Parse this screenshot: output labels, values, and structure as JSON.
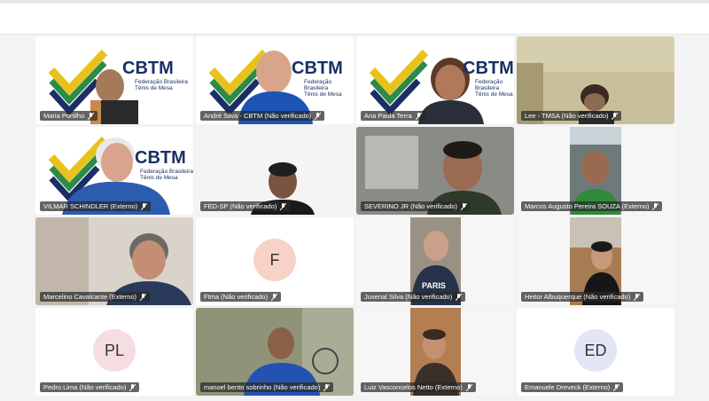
{
  "brand": {
    "logo_text": "CBTM",
    "logo_sub_1": "Federação Brasileira",
    "logo_sub_2": "Tênis de Mesa"
  },
  "participants": [
    {
      "name": "Maria Portilho"
    },
    {
      "name": "André Silva - CBTM (Não verificado)"
    },
    {
      "name": "Ana Paula Terra"
    },
    {
      "name": "Lee - TMSA (Não verificado)"
    },
    {
      "name": "VILMAR SCHINDLER (Externo)"
    },
    {
      "name": "FED-SP (Não verificado)"
    },
    {
      "name": "SEVERINO JR (Não verificado)"
    },
    {
      "name": "Marcos Augusto Pereira SOUZA (Externo)"
    },
    {
      "name": "Marcelino Cavalcante (Externo)"
    },
    {
      "name": "Ftma (Não verificado)",
      "initials": "F"
    },
    {
      "name": "Juvenal Silva (Não verificado)"
    },
    {
      "name": "Heitor Albuquerque (Não verificado)"
    },
    {
      "name": "Pedro Lima (Não verificado)",
      "initials": "PL"
    },
    {
      "name": "manoel bento sobrinho (Não verificado)"
    },
    {
      "name": "Luiz Vasconcelos Netto (Externo)"
    },
    {
      "name": "Emanuele Dreveck (Externo)",
      "initials": "ED"
    }
  ],
  "icons": {
    "muted": "mic-off-icon"
  },
  "colors": {
    "brand_blue": "#1a2f66",
    "brand_yellow": "#e8c21a",
    "brand_green": "#2d8a4a",
    "label_bg": "#282828"
  }
}
